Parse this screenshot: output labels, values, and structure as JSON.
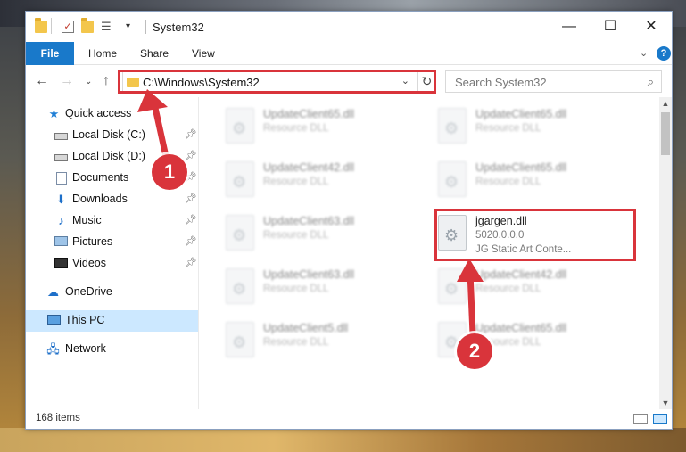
{
  "window": {
    "title": "System32",
    "controls": {
      "minimize": "—",
      "maximize": "☐",
      "close": "✕"
    }
  },
  "ribbon": {
    "tabs": [
      {
        "label": "File",
        "active": true
      },
      {
        "label": "Home"
      },
      {
        "label": "Share"
      },
      {
        "label": "View"
      }
    ],
    "help": "?"
  },
  "nav": {
    "address": "C:\\Windows\\System32",
    "search_placeholder": "Search System32"
  },
  "sidebar": {
    "items": [
      {
        "label": "Quick access",
        "icon": "star-icon"
      },
      {
        "label": "Local Disk (C:)",
        "icon": "disk-icon",
        "pinned": true
      },
      {
        "label": "Local Disk (D:)",
        "icon": "disk-icon",
        "pinned": true
      },
      {
        "label": "Documents",
        "icon": "document-icon",
        "pinned": true
      },
      {
        "label": "Downloads",
        "icon": "download-icon",
        "pinned": true
      },
      {
        "label": "Music",
        "icon": "music-icon",
        "pinned": true
      },
      {
        "label": "Pictures",
        "icon": "picture-icon",
        "pinned": true
      },
      {
        "label": "Videos",
        "icon": "video-icon",
        "pinned": true
      },
      {
        "label": "OneDrive",
        "icon": "cloud-icon"
      },
      {
        "label": "This PC",
        "icon": "computer-icon",
        "selected": true
      },
      {
        "label": "Network",
        "icon": "network-icon"
      }
    ]
  },
  "files": [
    {
      "name": "UpdateClient65.dll",
      "type": "Resource DLL"
    },
    {
      "name": "UpdateClient65.dll",
      "type": "Resource DLL"
    },
    {
      "name": "UpdateClient42.dll",
      "type": "Resource DLL"
    },
    {
      "name": "UpdateClient65.dll",
      "type": "Resource DLL"
    },
    {
      "name": "UpdateClient63.dll",
      "type": "Resource DLL"
    },
    {
      "name": "jgargen.dll",
      "version": "5020.0.0.0",
      "type": "JG Static Art Conte...",
      "highlighted": true
    },
    {
      "name": "UpdateClient63.dll",
      "type": "Resource DLL"
    },
    {
      "name": "UpdateClient42.dll",
      "type": "Resource DLL"
    },
    {
      "name": "UpdateClient5.dll",
      "type": "Resource DLL"
    },
    {
      "name": "UpdateClient65.dll",
      "type": "Resource DLL"
    }
  ],
  "status": {
    "item_count": "168 items"
  },
  "annotations": {
    "step1": "1",
    "step2": "2",
    "color": "#d9343b"
  }
}
